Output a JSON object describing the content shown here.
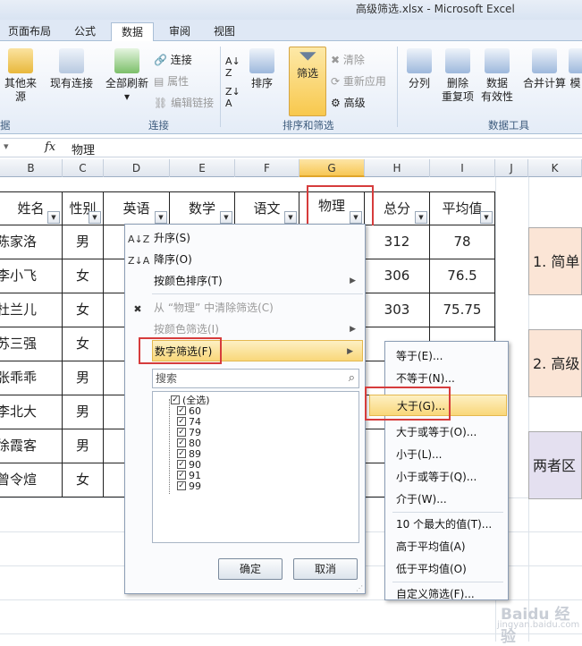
{
  "window": {
    "title": "高级筛选.xlsx - Microsoft Excel"
  },
  "tabs": [
    "页面布局",
    "公式",
    "数据",
    "审阅",
    "视图"
  ],
  "ribbon": {
    "other_sources": "其他来源",
    "existing_conn": "现有连接",
    "refresh_all": "全部刷新",
    "connections": "连接",
    "properties": "属性",
    "edit_links": "编辑链接",
    "sort": "排序",
    "filter": "筛选",
    "clear": "清除",
    "reapply": "重新应用",
    "advanced": "高级",
    "text_to_cols": "分列",
    "remove_dup": "删除\n重复项",
    "data_valid": "数据\n有效性",
    "consolidate": "合并计算",
    "model": "模",
    "group_partial": "据",
    "group_conn": "连接",
    "group_sort": "排序和筛选",
    "group_tools": "数据工具"
  },
  "formula": {
    "fx": "fx",
    "value": "物理"
  },
  "columns": [
    "B",
    "C",
    "D",
    "E",
    "F",
    "G",
    "H",
    "I",
    "J",
    "K"
  ],
  "headers": [
    "姓名",
    "性别",
    "英语",
    "数学",
    "语文",
    "物理",
    "总分",
    "平均值"
  ],
  "rows": [
    {
      "name": "陈家洛",
      "gender": "男",
      "total": "312",
      "avg": "78"
    },
    {
      "name": "李小飞",
      "gender": "女",
      "total": "306",
      "avg": "76.5"
    },
    {
      "name": "杜兰儿",
      "gender": "女",
      "total": "303",
      "avg": "75.75"
    },
    {
      "name": "苏三强",
      "gender": "女",
      "total": "",
      "avg": ""
    },
    {
      "name": "张乖乖",
      "gender": "男",
      "total": "",
      "avg": ""
    },
    {
      "name": "李北大",
      "gender": "男",
      "total": "",
      "avg": ""
    },
    {
      "name": "徐霞客",
      "gender": "男",
      "total": "",
      "avg": ""
    },
    {
      "name": "曾令煊",
      "gender": "女",
      "total": "",
      "avg": ""
    }
  ],
  "side_boxes": [
    "1. 简单",
    "2. 高级",
    "两者区"
  ],
  "menu": {
    "sort_asc": "升序(S)",
    "sort_desc": "降序(O)",
    "sort_color": "按颜色排序(T)",
    "clear_filter": "从 “物理” 中清除筛选(C)",
    "filter_color": "按颜色筛选(I)",
    "number_filter": "数字筛选(F)",
    "search_placeholder": "搜索",
    "items": [
      "(全选)",
      "60",
      "74",
      "79",
      "80",
      "89",
      "90",
      "91",
      "99"
    ],
    "ok": "确定",
    "cancel": "取消"
  },
  "submenu": [
    "等于(E)...",
    "不等于(N)...",
    "大于(G)...",
    "大于或等于(O)...",
    "小于(L)...",
    "小于或等于(Q)...",
    "介于(W)...",
    "10 个最大的值(T)...",
    "高于平均值(A)",
    "低于平均值(O)",
    "自定义筛选(F)..."
  ],
  "watermark": {
    "logo": "Baidu 经验",
    "url": "jingyan.baidu.com"
  },
  "colors": {
    "accent": "#f7c755",
    "highlight": "#d63c3c",
    "box1": "#fbe5d6",
    "box3": "#e4e0f0"
  }
}
